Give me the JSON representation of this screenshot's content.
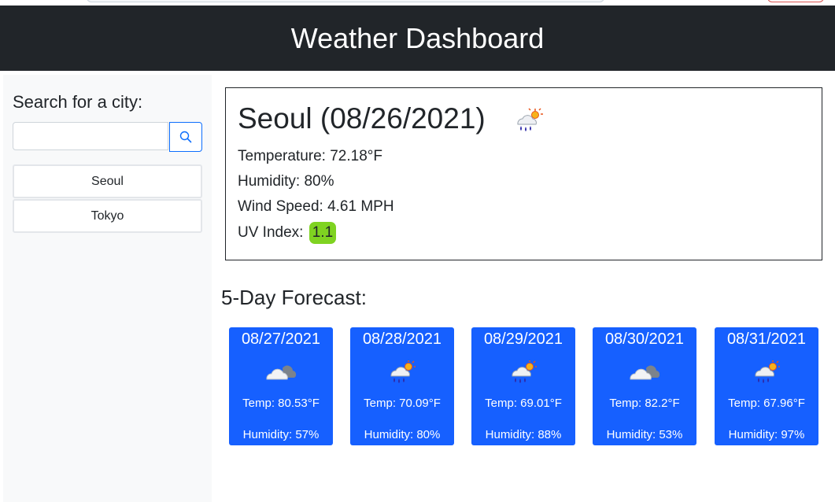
{
  "app": {
    "title": "Weather Dashboard"
  },
  "sidebar": {
    "title": "Search for a city:",
    "search": {
      "placeholder": "",
      "value": "",
      "button_icon": "search-icon"
    },
    "history": [
      {
        "label": "Seoul"
      },
      {
        "label": "Tokyo"
      }
    ]
  },
  "current": {
    "title": "Seoul (08/26/2021)",
    "icon": "rain-sun-icon",
    "temperature": "Temperature: 72.18°F",
    "humidity": "Humidity: 80%",
    "wind": "Wind Speed: 4.61 MPH",
    "uv_label": "UV Index:",
    "uv_value": "1.1",
    "uv_color": "#7fd321"
  },
  "forecast": {
    "title": "5-Day Forecast:",
    "card_color": "#1660ff",
    "days": [
      {
        "date": "08/27/2021",
        "icon": "cloud-icon",
        "temp": "Temp: 80.53°F",
        "humidity": "Humidity: 57%"
      },
      {
        "date": "08/28/2021",
        "icon": "rain-sun-icon",
        "temp": "Temp: 70.09°F",
        "humidity": "Humidity: 80%"
      },
      {
        "date": "08/29/2021",
        "icon": "rain-sun-icon",
        "temp": "Temp: 69.01°F",
        "humidity": "Humidity: 88%"
      },
      {
        "date": "08/30/2021",
        "icon": "cloud-icon",
        "temp": "Temp: 82.2°F",
        "humidity": "Humidity: 53%"
      },
      {
        "date": "08/31/2021",
        "icon": "rain-sun-icon",
        "temp": "Temp: 67.96°F",
        "humidity": "Humidity: 97%"
      }
    ]
  },
  "colors": {
    "header_bg": "#212529",
    "sidebar_bg": "#f8f9fa",
    "accent": "#0d6efd"
  }
}
